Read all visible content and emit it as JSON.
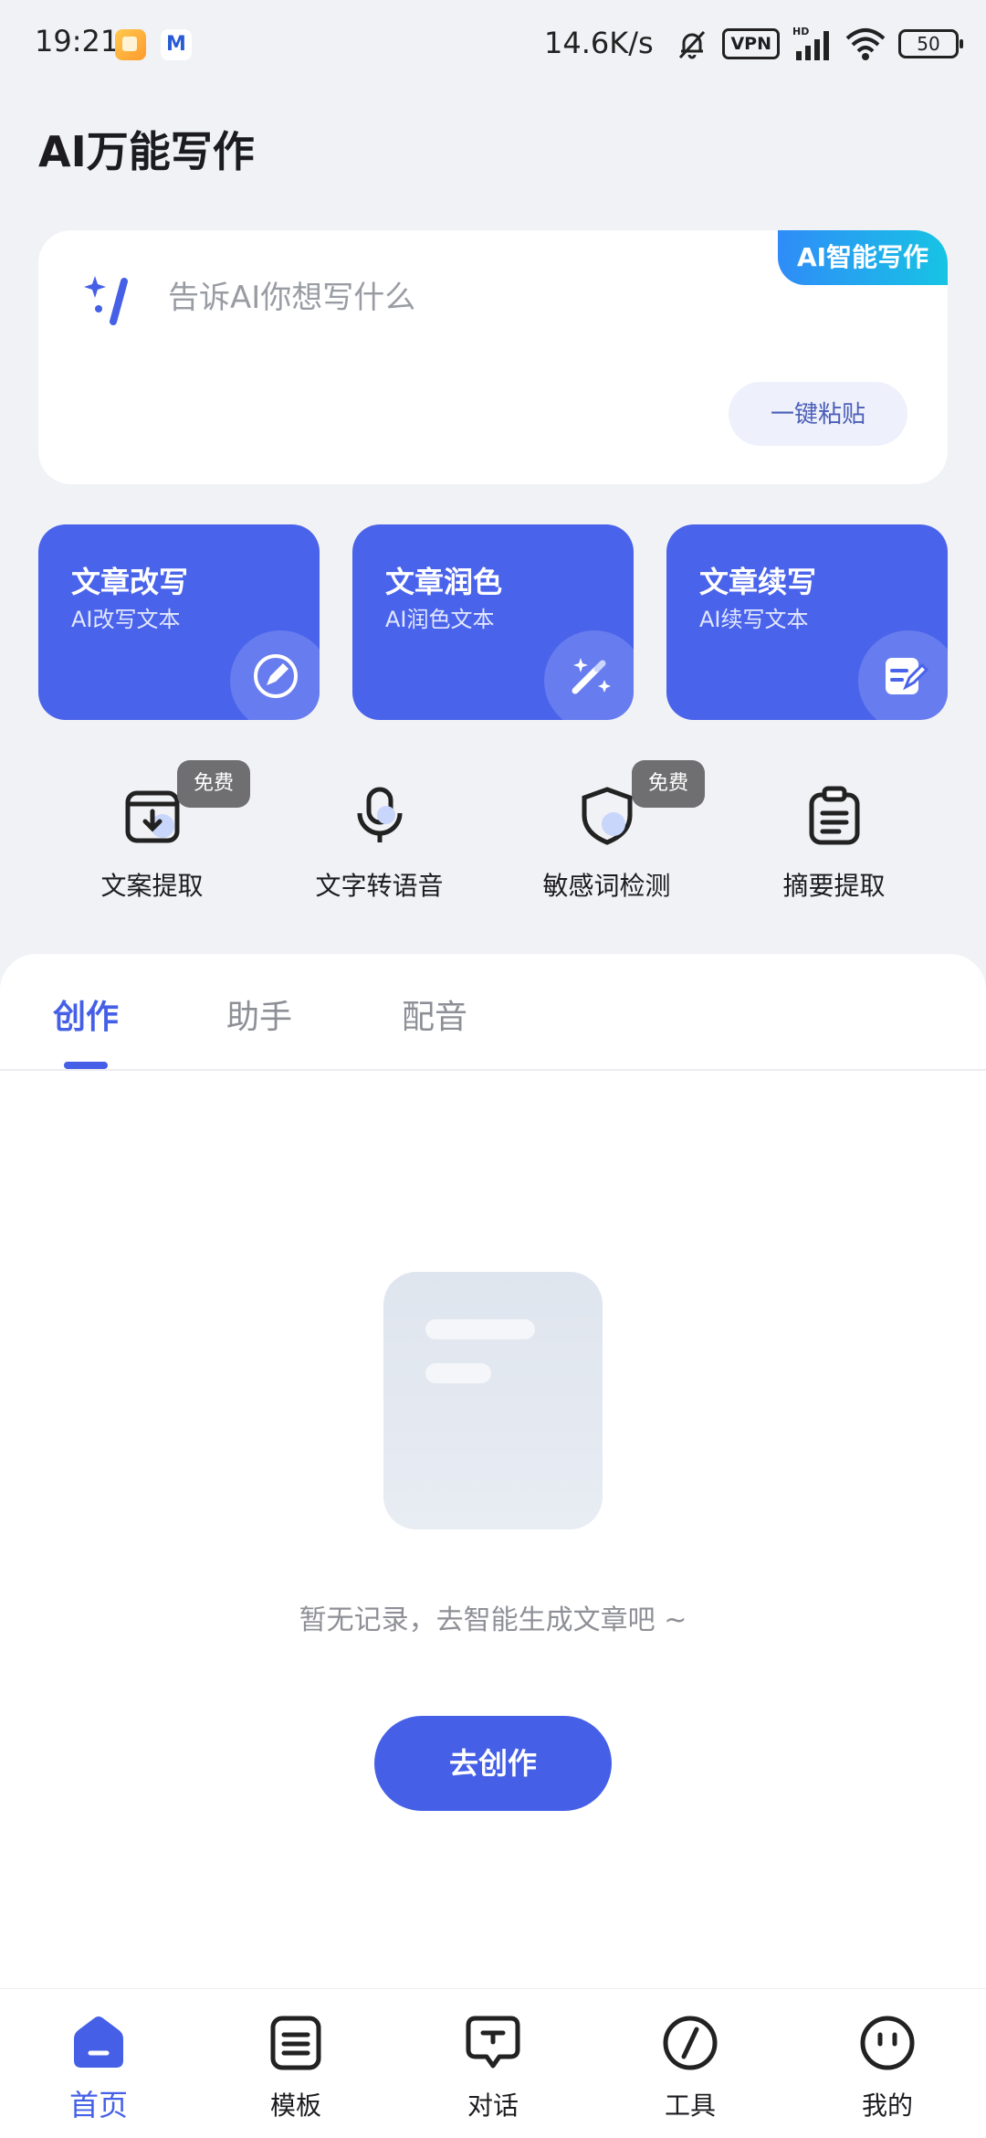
{
  "status_bar": {
    "time": "19:21",
    "net_speed": "14.6K/s",
    "vpn": "VPN",
    "hd": "HD",
    "battery": "50"
  },
  "page_title": "AI万能写作",
  "prompt_card": {
    "badge": "AI智能写作",
    "placeholder": "告诉AI你想写什么",
    "paste_button": "一键粘贴"
  },
  "features": [
    {
      "title": "文章改写",
      "subtitle": "AI改写文本",
      "icon": "pen-circle-icon"
    },
    {
      "title": "文章润色",
      "subtitle": "AI润色文本",
      "icon": "magic-wand-icon"
    },
    {
      "title": "文章续写",
      "subtitle": "AI续写文本",
      "icon": "edit-note-icon"
    }
  ],
  "tools": [
    {
      "label": "文案提取",
      "badge": "免费",
      "icon": "download-box-icon"
    },
    {
      "label": "文字转语音",
      "badge": "",
      "icon": "microphone-icon"
    },
    {
      "label": "敏感词检测",
      "badge": "免费",
      "icon": "shield-icon"
    },
    {
      "label": "摘要提取",
      "badge": "",
      "icon": "clipboard-icon"
    }
  ],
  "tabs": [
    "创作",
    "助手",
    "配音"
  ],
  "active_tab": "创作",
  "empty_state": {
    "text": "暂无记录，去智能生成文章吧 ~",
    "button": "去创作"
  },
  "bottom_nav": [
    {
      "label": "首页",
      "icon": "home-icon",
      "active": true
    },
    {
      "label": "模板",
      "icon": "template-icon",
      "active": false
    },
    {
      "label": "对话",
      "icon": "chat-icon",
      "active": false
    },
    {
      "label": "工具",
      "icon": "tool-icon",
      "active": false
    },
    {
      "label": "我的",
      "icon": "profile-icon",
      "active": false
    }
  ],
  "colors": {
    "accent": "#4560e6",
    "card_blue": "#4a63eb",
    "background": "#f1f2f6",
    "badge_gradient_start": "#2f8cf8",
    "badge_gradient_end": "#17c4e4"
  }
}
